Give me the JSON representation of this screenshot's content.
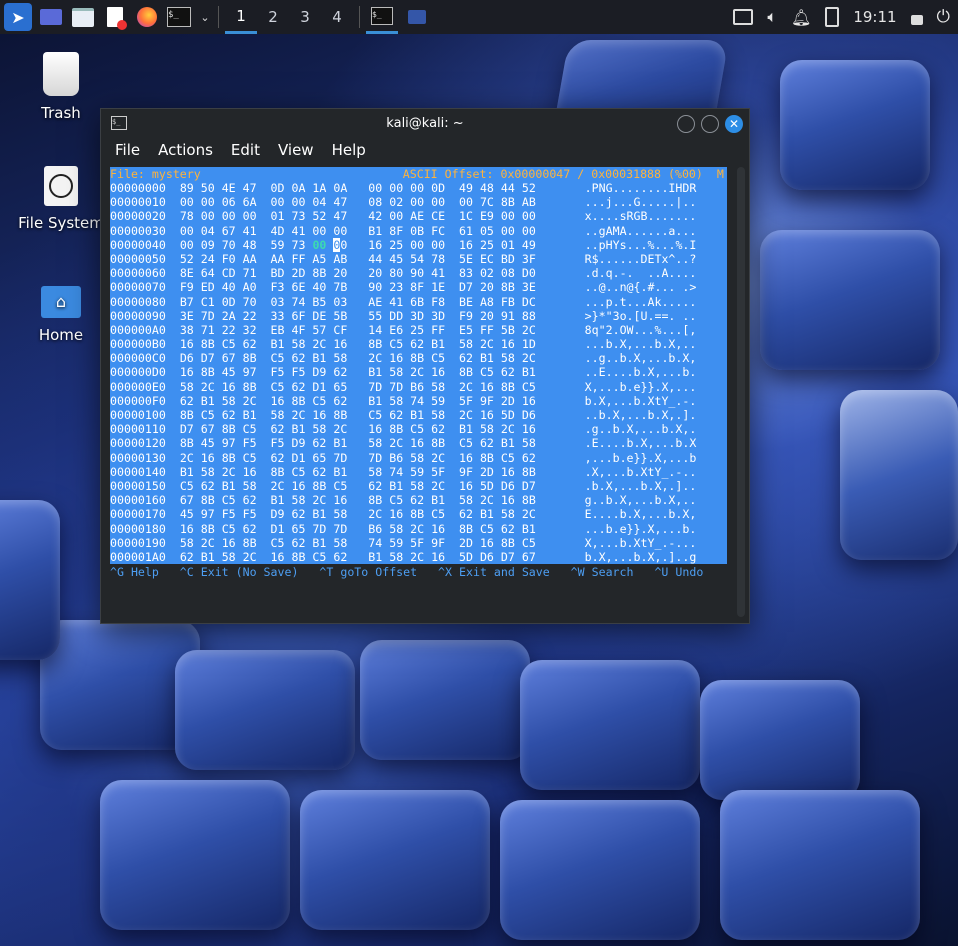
{
  "taskbar": {
    "workspaces": [
      "1",
      "2",
      "3",
      "4"
    ],
    "clock": "19:11"
  },
  "desktop": {
    "icons": [
      {
        "label": "Trash"
      },
      {
        "label": "File System"
      },
      {
        "label": "Home"
      }
    ]
  },
  "window": {
    "title": "kali@kali: ~",
    "menu": [
      "File",
      "Actions",
      "Edit",
      "View",
      "Help"
    ]
  },
  "hexed": {
    "status_left": "File: mystery",
    "status_right": "ASCII Offset: 0x00000047 / 0x00031888 (%00)  M",
    "rows": [
      {
        "off": "00000000",
        "hex": "89 50 4E 47  0D 0A 1A 0A   00 00 00 0D  49 48 44 52",
        "ascii": ".PNG........IHDR"
      },
      {
        "off": "00000010",
        "hex": "00 00 06 6A  00 00 04 47   08 02 00 00  00 7C 8B AB",
        "ascii": "...j...G.....|.."
      },
      {
        "off": "00000020",
        "hex": "78 00 00 00  01 73 52 47   42 00 AE CE  1C E9 00 00",
        "ascii": "x....sRGB......."
      },
      {
        "off": "00000030",
        "hex": "00 04 67 41  4D 41 00 00   B1 8F 0B FC  61 05 00 00",
        "ascii": "..gAMA......a..."
      },
      {
        "off": "00000040",
        "hex": "00 09 70 48  59 73 00 00   16 25 00 00  16 25 01 49",
        "ascii": "..pHYs...%...%.I"
      },
      {
        "off": "00000050",
        "hex": "52 24 F0 AA  AA FF A5 AB   44 45 54 78  5E EC BD 3F",
        "ascii": "R$......DETx^..?"
      },
      {
        "off": "00000060",
        "hex": "8E 64 CD 71  BD 2D 8B 20   20 80 90 41  83 02 08 D0",
        "ascii": ".d.q.-.  ..A...."
      },
      {
        "off": "00000070",
        "hex": "F9 ED 40 A0  F3 6E 40 7B   90 23 8F 1E  D7 20 8B 3E",
        "ascii": "..@..n@{.#... .>"
      },
      {
        "off": "00000080",
        "hex": "B7 C1 0D 70  03 74 B5 03   AE 41 6B F8  BE A8 FB DC",
        "ascii": "...p.t...Ak....."
      },
      {
        "off": "00000090",
        "hex": "3E 7D 2A 22  33 6F DE 5B   55 DD 3D 3D  F9 20 91 88",
        "ascii": ">}*\"3o.[U.==. .."
      },
      {
        "off": "000000A0",
        "hex": "38 71 22 32  EB 4F 57 CF   14 E6 25 FF  E5 FF 5B 2C",
        "ascii": "8q\"2.OW...%...[,"
      },
      {
        "off": "000000B0",
        "hex": "16 8B C5 62  B1 58 2C 16   8B C5 62 B1  58 2C 16 1D",
        "ascii": "...b.X,...b.X,.."
      },
      {
        "off": "000000C0",
        "hex": "D6 D7 67 8B  C5 62 B1 58   2C 16 8B C5  62 B1 58 2C",
        "ascii": "..g..b.X,...b.X,"
      },
      {
        "off": "000000D0",
        "hex": "16 8B 45 97  F5 F5 D9 62   B1 58 2C 16  8B C5 62 B1",
        "ascii": "..E....b.X,...b."
      },
      {
        "off": "000000E0",
        "hex": "58 2C 16 8B  C5 62 D1 65   7D 7D B6 58  2C 16 8B C5",
        "ascii": "X,...b.e}}.X,..."
      },
      {
        "off": "000000F0",
        "hex": "62 B1 58 2C  16 8B C5 62   B1 58 74 59  5F 9F 2D 16",
        "ascii": "b.X,...b.XtY_.-."
      },
      {
        "off": "00000100",
        "hex": "8B C5 62 B1  58 2C 16 8B   C5 62 B1 58  2C 16 5D D6",
        "ascii": "..b.X,...b.X,.]."
      },
      {
        "off": "00000110",
        "hex": "D7 67 8B C5  62 B1 58 2C   16 8B C5 62  B1 58 2C 16",
        "ascii": ".g..b.X,...b.X,."
      },
      {
        "off": "00000120",
        "hex": "8B 45 97 F5  F5 D9 62 B1   58 2C 16 8B  C5 62 B1 58",
        "ascii": ".E....b.X,...b.X"
      },
      {
        "off": "00000130",
        "hex": "2C 16 8B C5  62 D1 65 7D   7D B6 58 2C  16 8B C5 62",
        "ascii": ",...b.e}}.X,...b"
      },
      {
        "off": "00000140",
        "hex": "B1 58 2C 16  8B C5 62 B1   58 74 59 5F  9F 2D 16 8B",
        "ascii": ".X,...b.XtY_.-.."
      },
      {
        "off": "00000150",
        "hex": "C5 62 B1 58  2C 16 8B C5   62 B1 58 2C  16 5D D6 D7",
        "ascii": ".b.X,...b.X,.].."
      },
      {
        "off": "00000160",
        "hex": "67 8B C5 62  B1 58 2C 16   8B C5 62 B1  58 2C 16 8B",
        "ascii": "g..b.X,...b.X,.."
      },
      {
        "off": "00000170",
        "hex": "45 97 F5 F5  D9 62 B1 58   2C 16 8B C5  62 B1 58 2C",
        "ascii": "E....b.X,...b.X,"
      },
      {
        "off": "00000180",
        "hex": "16 8B C5 62  D1 65 7D 7D   B6 58 2C 16  8B C5 62 B1",
        "ascii": "...b.e}}.X,...b."
      },
      {
        "off": "00000190",
        "hex": "58 2C 16 8B  C5 62 B1 58   74 59 5F 9F  2D 16 8B C5",
        "ascii": "X,...b.XtY_.-..."
      },
      {
        "off": "000001A0",
        "hex": "62 B1 58 2C  16 8B C5 62   B1 58 2C 16  5D D6 D7 67",
        "ascii": "b.X,...b.X,.]..g"
      }
    ],
    "footer": "^G Help   ^C Exit (No Save)   ^T goTo Offset   ^X Exit and Save   ^W Search   ^U Undo"
  },
  "colors": {
    "hex_bg": "#3e8ff0",
    "status_fg": "#ffb33b",
    "accent": "#3a8fd6"
  }
}
